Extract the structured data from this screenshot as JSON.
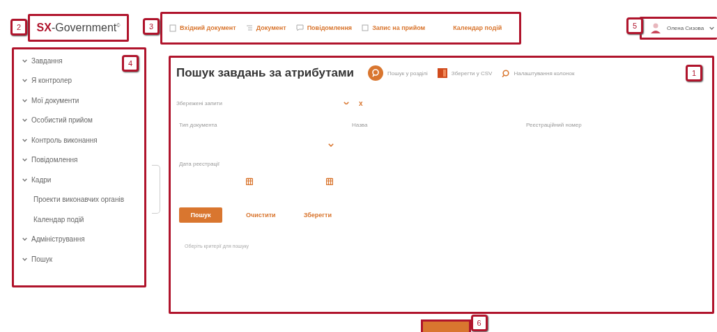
{
  "logo": {
    "brand": "SX",
    "name": "-Government",
    "mark": "©",
    "badge": "2"
  },
  "toolbar": {
    "badge": "3",
    "items": [
      {
        "label": "Вхідний документ",
        "kind": "doc"
      },
      {
        "label": "Документ",
        "kind": "list"
      },
      {
        "label": "Повідомлення",
        "kind": "message"
      },
      {
        "label": "Запис на прийом",
        "kind": "calendar"
      },
      {
        "label": "Календар подій",
        "kind": "none"
      }
    ]
  },
  "user": {
    "name": "Олена Сизова",
    "badge": "5"
  },
  "sidebar": {
    "badge": "4",
    "items": [
      {
        "label": "Завдання",
        "kind": "group"
      },
      {
        "label": "Я контролер",
        "kind": "group"
      },
      {
        "label": "Мої документи",
        "kind": "group"
      },
      {
        "label": "Особистий прийом",
        "kind": "group"
      },
      {
        "label": "Контроль виконання",
        "kind": "group"
      },
      {
        "label": "Повідомлення",
        "kind": "group"
      },
      {
        "label": "Кадри",
        "kind": "group"
      },
      {
        "label": "Проекти виконавчих органів",
        "kind": "link"
      },
      {
        "label": "Календар подій",
        "kind": "link"
      },
      {
        "label": "Адміністрування",
        "kind": "group"
      },
      {
        "label": "Пошук",
        "kind": "group"
      }
    ]
  },
  "main": {
    "badge": "1",
    "title": "Пошук завдань за атрибутами",
    "actions": [
      {
        "label": "Пошук у розділі",
        "kind": "search-round"
      },
      {
        "label": "Зберегти у CSV",
        "kind": "office"
      },
      {
        "label": "Налаштування колонок",
        "kind": "search"
      }
    ],
    "saved_queries": {
      "placeholder": "Збережені запити",
      "clear": "x"
    },
    "fields": [
      {
        "label": "Тип документа",
        "kind": "select"
      },
      {
        "label": "Назва",
        "kind": "text"
      },
      {
        "label": "Реєстраційний номер",
        "kind": "text"
      }
    ],
    "date": {
      "label": "Дата реєстрації"
    },
    "buttons": [
      {
        "label": "Пошук",
        "kind": "primary"
      },
      {
        "label": "Очистити",
        "kind": "link"
      },
      {
        "label": "Зберегти",
        "kind": "link"
      }
    ],
    "hint": "Оберіть критерії для пошуку"
  },
  "footer": {
    "badge": "6"
  }
}
